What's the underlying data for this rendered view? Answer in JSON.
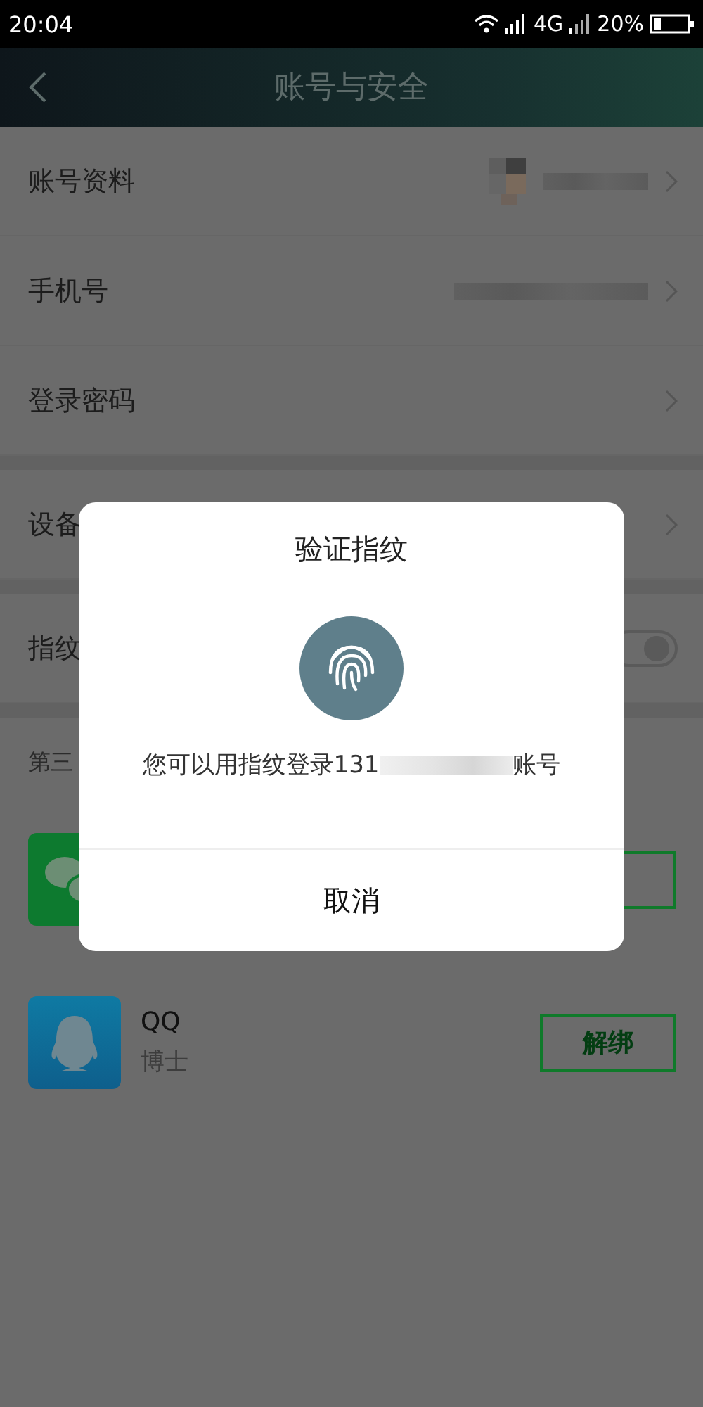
{
  "status_bar": {
    "time": "20:04",
    "network": "4G",
    "battery": "20%"
  },
  "header": {
    "title": "账号与安全"
  },
  "setting_groups": [
    [
      {
        "kind": "profile",
        "label": "账号资料"
      },
      {
        "kind": "masked",
        "label": "手机号"
      },
      {
        "kind": "link",
        "label": "登录密码"
      }
    ],
    [
      {
        "kind": "link",
        "label": "设备"
      }
    ],
    [
      {
        "kind": "switch",
        "label": "指纹",
        "on": true
      }
    ]
  ],
  "third_party": {
    "heading": "第三",
    "accounts": [
      {
        "kind": "wechat"
      },
      {
        "kind": "qq",
        "name": "QQ",
        "nickname": "博士",
        "action": "解绑"
      }
    ]
  },
  "dialog": {
    "title": "验证指纹",
    "message": "您可以用指纹登录131",
    "message_end": "账号",
    "cancel": "取消"
  }
}
